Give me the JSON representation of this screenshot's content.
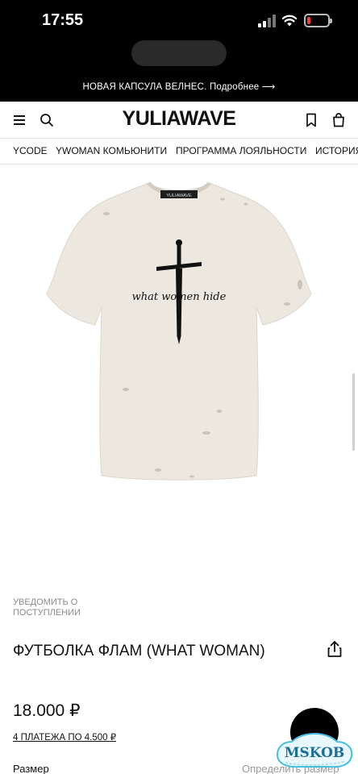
{
  "status": {
    "time": "17:55",
    "battery_color": "#ff3b30",
    "battery_level": 0.18
  },
  "announcement": {
    "text": "НОВАЯ КАПСУЛА ВЕЛНЕС. Подробнее ⟶"
  },
  "header": {
    "logo": "YULIAWAVE",
    "icons": [
      "menu-icon",
      "search-icon",
      "bookmark-icon",
      "bag-icon"
    ]
  },
  "nav": {
    "items": [
      {
        "label": "YCODE"
      },
      {
        "label": "YWOMAN КОМЬЮНИТИ"
      },
      {
        "label": "ПРОГРАММА ЛОЯЛЬНОСТИ"
      },
      {
        "label": "ИСТОРИЯ"
      }
    ]
  },
  "product": {
    "print_text": "what women hide",
    "collar_label": "YULIAWAVE",
    "notify_text": "УВЕДОМИТЬ О ПОСТУПЛЕНИИ",
    "title": "ФУТБОЛКА ФЛАМ (WHAT WOMAN)",
    "price": "18.000 ₽",
    "installments": "4 ПЛАТЕЖА ПО 4.500 ₽",
    "size_label": "Размер",
    "size_guide": "Определить размер"
  },
  "watermark": {
    "text": "MSKOB"
  }
}
